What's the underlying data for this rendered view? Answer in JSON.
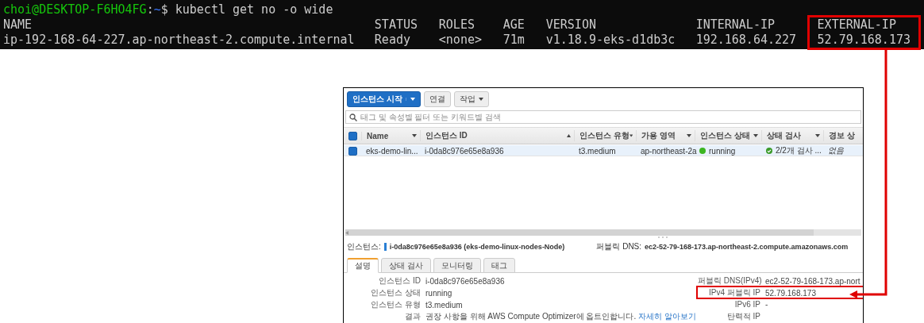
{
  "terminal": {
    "prompt_user": "choi@DESKTOP-F6HO4FG",
    "prompt_separator": ":",
    "prompt_path": "~",
    "command": "$ kubectl get no -o wide",
    "columns": [
      {
        "header": "NAME",
        "value": "ip-192-168-64-227.ap-northeast-2.compute.internal",
        "highlighted": false
      },
      {
        "header": "STATUS",
        "value": "Ready",
        "highlighted": false
      },
      {
        "header": "ROLES",
        "value": "<none>",
        "highlighted": false
      },
      {
        "header": "AGE",
        "value": "71m",
        "highlighted": false
      },
      {
        "header": "VERSION",
        "value": "v1.18.9-eks-d1db3c",
        "highlighted": false
      },
      {
        "header": "INTERNAL-IP",
        "value": "192.168.64.227",
        "highlighted": false
      },
      {
        "header": "EXTERNAL-IP",
        "value": "52.79.168.173",
        "highlighted": true
      }
    ]
  },
  "console": {
    "toolbar": [
      {
        "label": "인스턴스 시작",
        "kind": "primary"
      },
      {
        "label": "연결",
        "kind": "plain"
      },
      {
        "label": "작업",
        "kind": "menu"
      }
    ],
    "search": {
      "placeholder": "태그 및 속성별 필터 또는 키워드별 검색"
    },
    "table": {
      "all_checked": true,
      "columns": [
        {
          "label": "Name",
          "kind": "caret"
        },
        {
          "label": "인스턴스 ID",
          "kind": "sort"
        },
        {
          "label": "인스턴스 유형",
          "kind": "caret"
        },
        {
          "label": "가용 영역",
          "kind": "caret"
        },
        {
          "label": "인스턴스 상태",
          "kind": "caret"
        },
        {
          "label": "상태 검사",
          "kind": "caret"
        },
        {
          "label": "경보 상",
          "kind": "plain"
        }
      ],
      "rows": [
        {
          "selected": true,
          "name": "eks-demo-lin...",
          "instance_id": "i-0da8c976e65e8a936",
          "type": "t3.medium",
          "zone": "ap-northeast-2a",
          "state": "running",
          "color": "#3cb521",
          "check": "2/2개 검사 ...",
          "alarm": "없음"
        }
      ]
    },
    "selected_instance": {
      "label": "인스턴스:",
      "id": "i-0da8c976e65e8a936 (eks-demo-linux-nodes-Node)",
      "dns_label": "퍼블릭 DNS:",
      "dns": "ec2-52-79-168-173.ap-northeast-2.compute.amazonaws.com"
    },
    "tabs": [
      {
        "label": "설명",
        "selected": true
      },
      {
        "label": "상태 검사",
        "selected": false
      },
      {
        "label": "모니터링",
        "selected": false
      },
      {
        "label": "태그",
        "selected": false
      }
    ],
    "details_left": [
      {
        "label": "인스턴스 ID",
        "value": "i-0da8c976e65e8a936"
      },
      {
        "label": "인스턴스 상태",
        "value": "running"
      },
      {
        "label": "인스턴스 유형",
        "value": "t3.medium"
      },
      {
        "label": "결과",
        "value": "권장 사항을 위해 AWS Compute Optimizer에 옵트인합니다.",
        "link": "자세히 알아보기"
      }
    ],
    "details_right": [
      {
        "label": "퍼블릭 DNS(IPv4)",
        "value": "ec2-52-79-168-173.ap-nort",
        "highlighted": false
      },
      {
        "label": "IPv4 퍼블릭 IP",
        "value": "52.79.168.173",
        "highlighted": true
      },
      {
        "label": "IPv6 IP",
        "value": "-",
        "highlighted": false
      },
      {
        "label": "탄력적 IP",
        "highlighted": false
      }
    ]
  }
}
